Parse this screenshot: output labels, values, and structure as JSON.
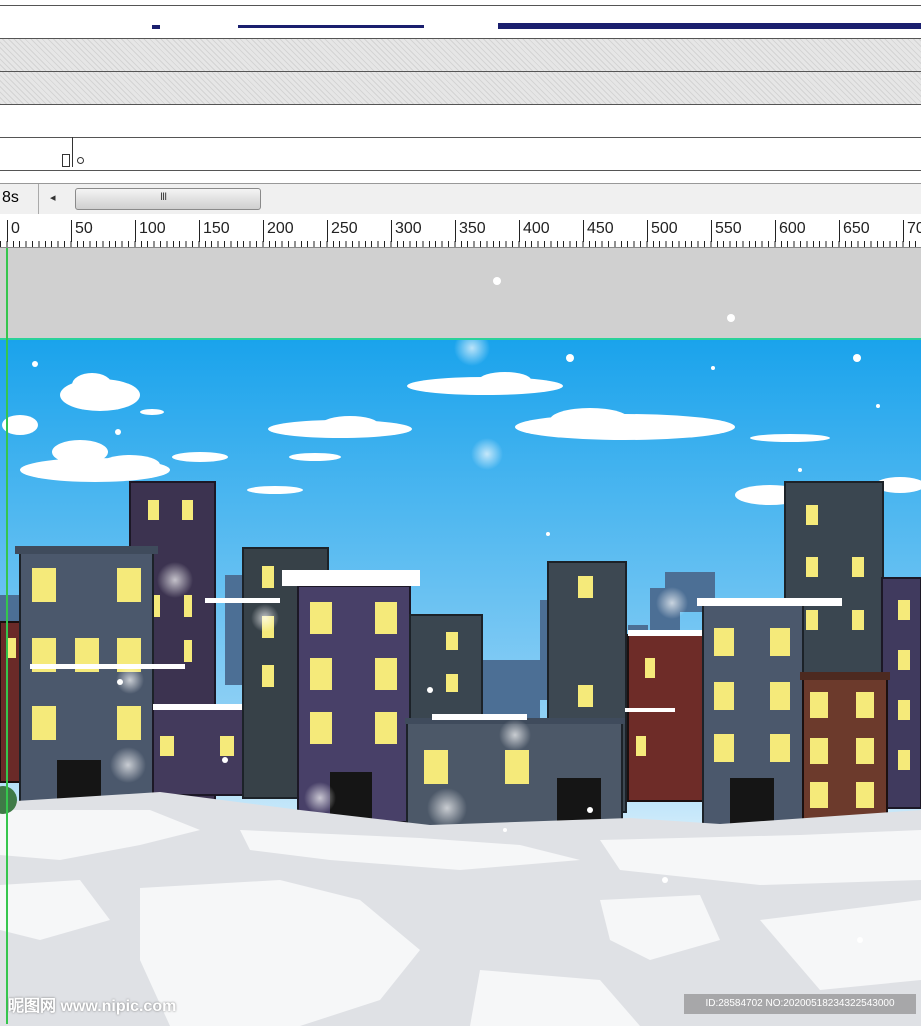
{
  "timeline": {
    "current_time": "8s",
    "scroll_left_arrow": "◂",
    "scroll_thumb_grip": "III"
  },
  "ruler": {
    "labels": [
      "0",
      "50",
      "100",
      "150",
      "200",
      "250",
      "300",
      "350",
      "400",
      "450",
      "500",
      "550",
      "600",
      "650",
      "70"
    ]
  },
  "stage": {
    "sky_colors": [
      "#1aa3ec",
      "#dff2fc"
    ],
    "snow_color": "#f4f6f8"
  },
  "watermark": {
    "logo": "昵图网 www.nipic.com",
    "id": "ID:28584702 NO:20200518234322543000"
  }
}
